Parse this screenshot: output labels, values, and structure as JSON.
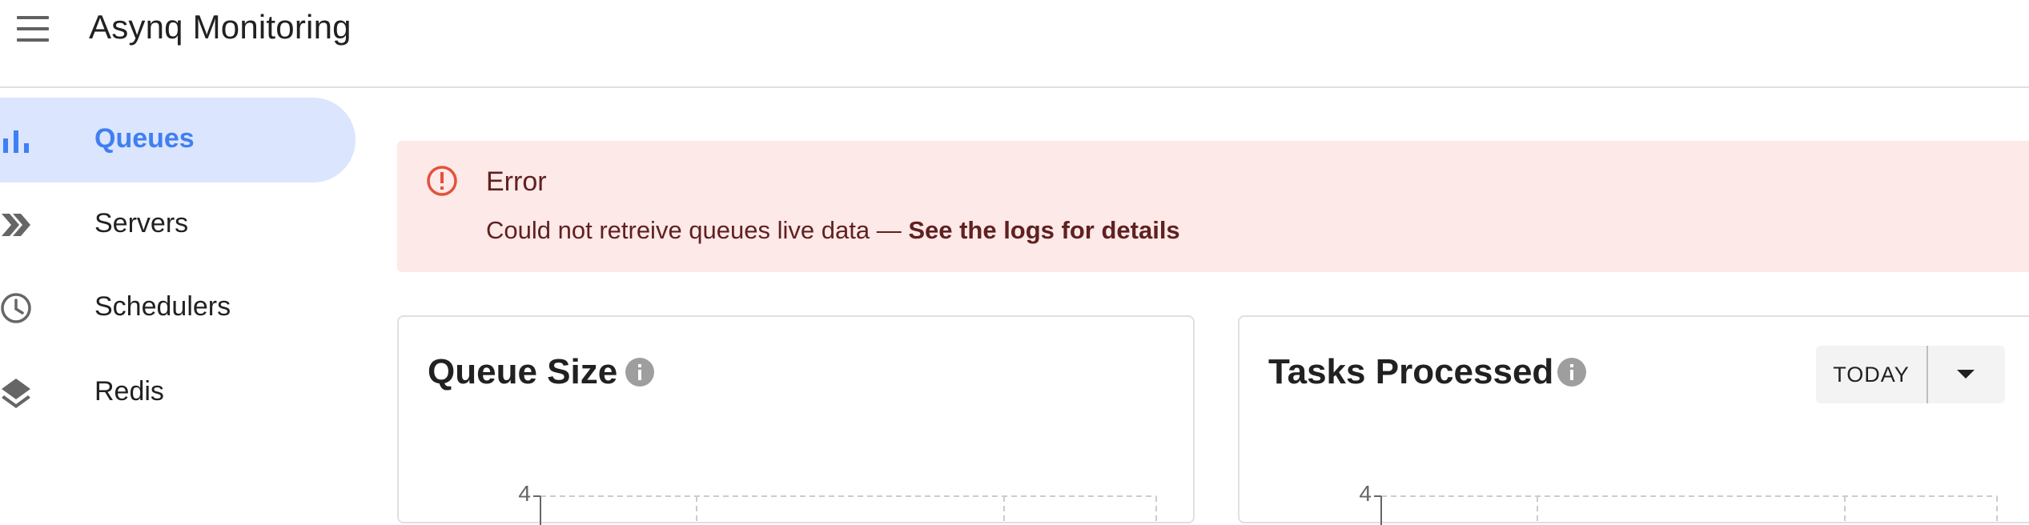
{
  "app": {
    "title": "Asynq Monitoring"
  },
  "sidebar": {
    "items": [
      {
        "label": "Queues",
        "icon": "bar-chart-icon",
        "active": true
      },
      {
        "label": "Servers",
        "icon": "double-chevron-icon",
        "active": false
      },
      {
        "label": "Schedulers",
        "icon": "clock-icon",
        "active": false
      },
      {
        "label": "Redis",
        "icon": "layers-icon",
        "active": false
      }
    ]
  },
  "alert": {
    "title": "Error",
    "message": "Could not retreive queues live data — ",
    "link": "See the logs for details",
    "icon": "error-outline-icon"
  },
  "cards": {
    "queue_size": {
      "title": "Queue Size",
      "y_tick": "4"
    },
    "tasks_processed": {
      "title": "Tasks Processed",
      "y_tick": "4",
      "range": "TODAY"
    }
  },
  "colors": {
    "accent": "#3f7ff3",
    "active_bg": "#dbe5fd",
    "alert_bg": "#fde9e7",
    "alert_text": "#5f2120",
    "alert_icon": "#e4513b"
  }
}
